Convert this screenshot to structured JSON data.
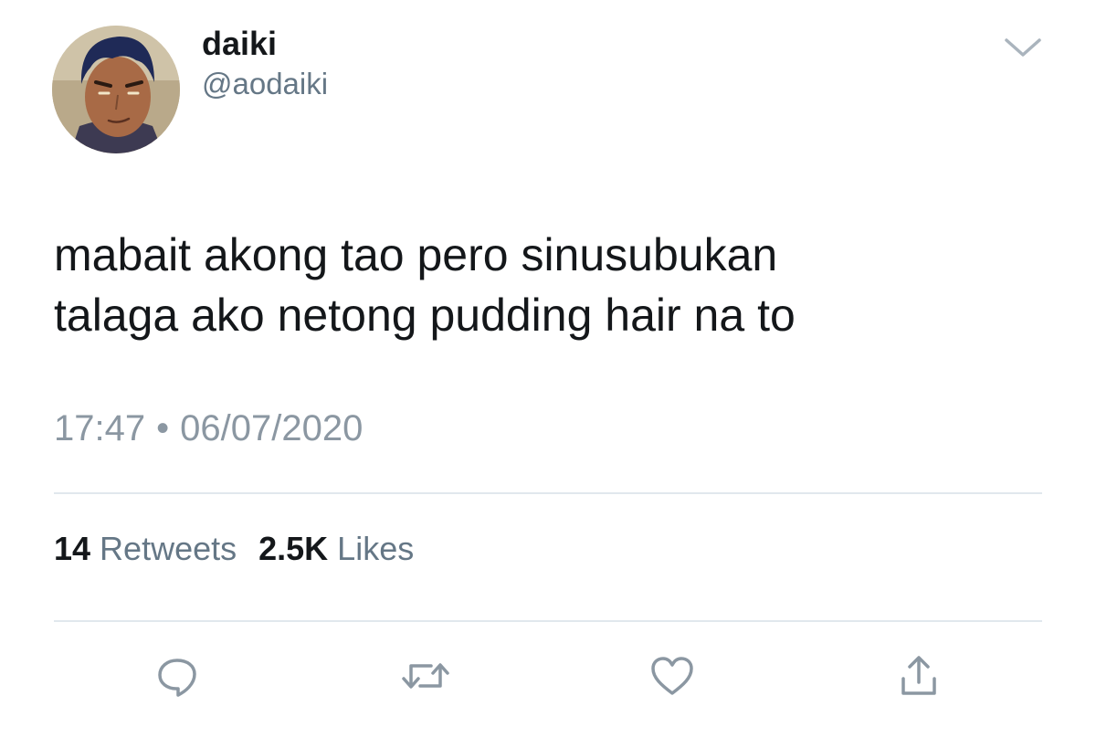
{
  "user": {
    "display_name": "daiki",
    "handle": "@aodaiki",
    "avatar_icon": "anime-avatar"
  },
  "tweet": {
    "text_lines": [
      "mabait akong tao pero sinusubukan",
      "talaga ako netong pudding hair na to"
    ],
    "time": "17:47",
    "separator": "•",
    "date": "06/07/2020"
  },
  "stats": {
    "retweets_count": "14",
    "retweets_label": "Retweets",
    "likes_count": "2.5K",
    "likes_label": "Likes"
  },
  "actions": {
    "reply_icon": "reply-icon",
    "retweet_icon": "retweet-icon",
    "like_icon": "heart-icon",
    "share_icon": "share-icon"
  },
  "colors": {
    "text": "#14171a",
    "secondary": "#657786",
    "timestamp": "#8b97a2",
    "divider": "#e1e8ed",
    "icon": "#8b97a2"
  }
}
